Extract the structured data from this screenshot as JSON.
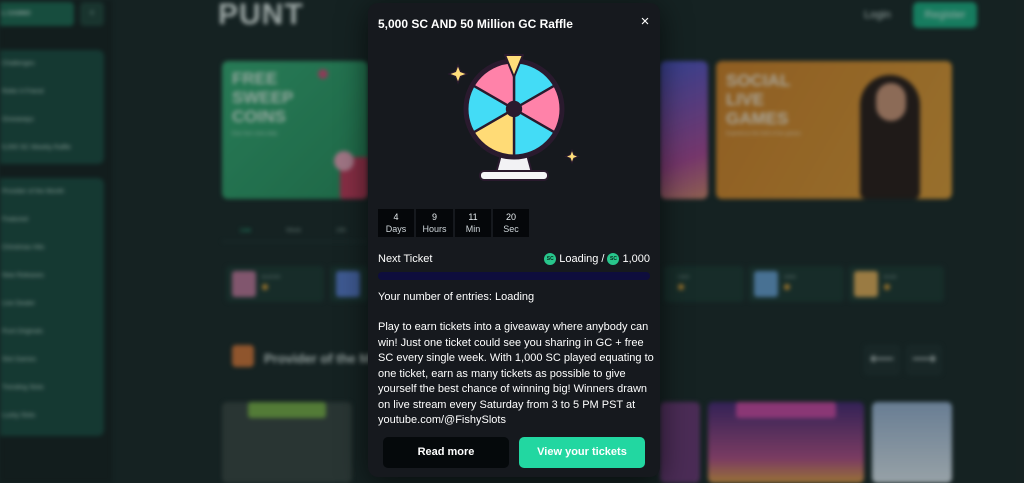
{
  "background": {
    "sidebar": {
      "casino_label": "L CASINO",
      "toggle_icon": "chevron-left-icon",
      "group1": [
        "Challenges",
        "Refer A Friend",
        "Giveaways",
        "5,000 SC Weekly Raffle"
      ],
      "group2": [
        "Provider of the Month",
        "Featured",
        "Christmas Hits",
        "New Releases",
        "Live Dealer",
        "Punt Originals",
        "Slot Games",
        "Trending Slots",
        "Lucky Slots"
      ]
    },
    "header": {
      "logo": "PUNT",
      "login": "Login",
      "register": "Register"
    },
    "banners": {
      "green_title": "FREE\nSWEEP\nCOINS",
      "green_sub": "Earn free coins daily",
      "orange_title": "SOCIAL\nLIVE\nGAMES",
      "orange_sub": "Experience the thrill of live games"
    },
    "tabs": [
      "Live",
      "Week",
      "24h"
    ],
    "strip_games": [
      "BLASTER",
      "WIN",
      "CASH",
      "SUGAR",
      "GEMS",
      "BLAZE"
    ],
    "provider_title": "Provider of the M",
    "prev_arrow": "⟵",
    "next_arrow": "⟶"
  },
  "modal": {
    "title": "5,000 SC AND 50 Million GC Raffle",
    "close_icon": "×",
    "countdown": [
      {
        "value": "4",
        "label": "Days"
      },
      {
        "value": "9",
        "label": "Hours"
      },
      {
        "value": "11",
        "label": "Min"
      },
      {
        "value": "20",
        "label": "Sec"
      }
    ],
    "next_ticket_label": "Next Ticket",
    "sc_badge": "SC",
    "current": "Loading",
    "separator": "/",
    "target": "1,000",
    "progress": 0,
    "entries": "Your number of entries: Loading",
    "description": "Play to earn tickets into a giveaway where anybody can win! Just one ticket could see you sharing in GC + free SC every single week. With 1,000 SC played equating to one ticket, earn as many tickets as possible to give yourself the best chance of winning big! Winners drawn on live stream every Saturday from 3 to 5 PM PST at youtube.com/@FishySlots",
    "read_more": "Read more",
    "view_tickets": "View your tickets"
  },
  "colors": {
    "modal_bg": "#16191e",
    "accent": "#22d7a1",
    "progress_track": "#0e0d3d",
    "wheel_pink": "#ff82a9",
    "wheel_cyan": "#43dcf6",
    "wheel_yellow": "#ffdb76"
  }
}
